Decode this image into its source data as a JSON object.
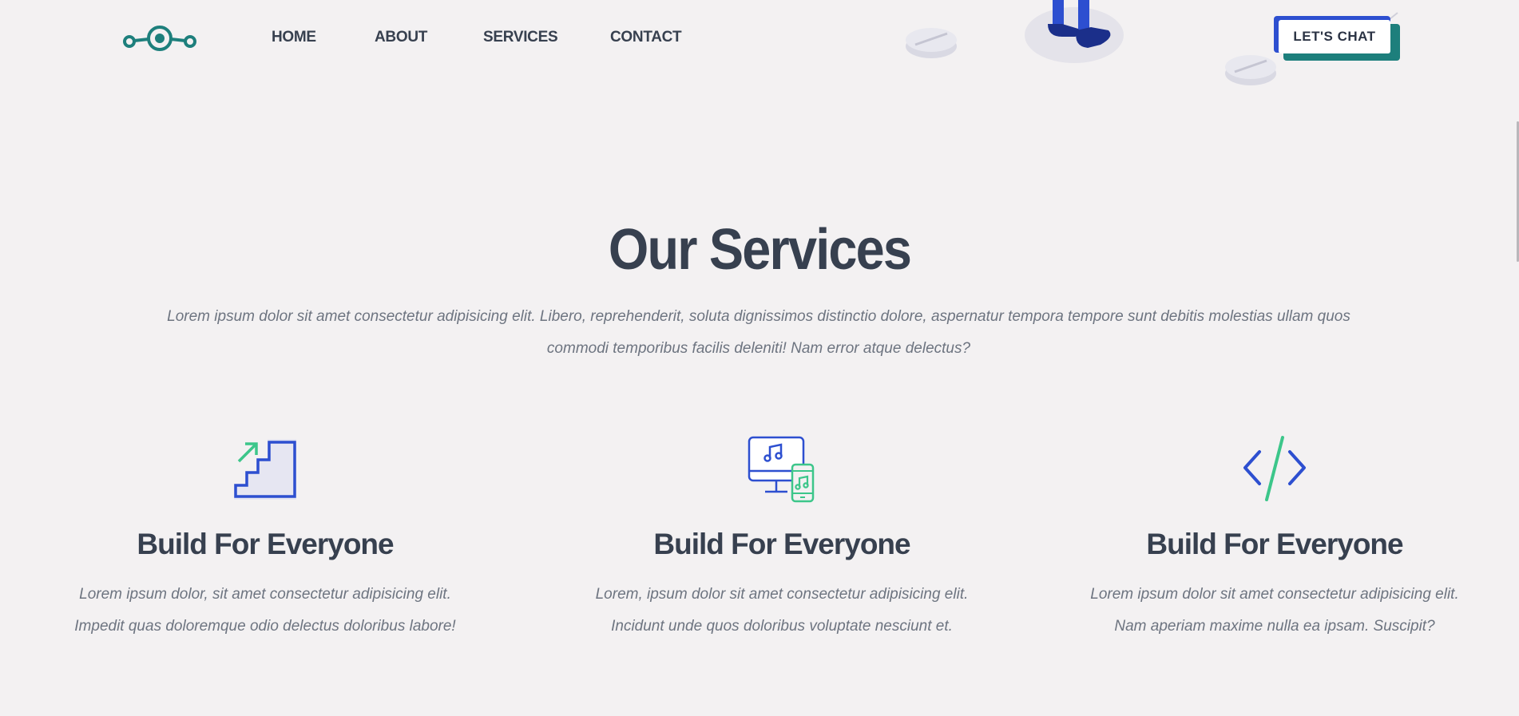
{
  "nav": {
    "items": [
      {
        "label": "HOME"
      },
      {
        "label": "ABOUT"
      },
      {
        "label": "SERVICES"
      },
      {
        "label": "CONTACT"
      }
    ],
    "cta_label": "LET'S CHAT"
  },
  "services": {
    "title": "Our Services",
    "intro_line1": "Lorem ipsum dolor sit amet consectetur adipisicing elit. Libero, reprehenderit, soluta dignissimos distinctio dolore, aspernatur tempora tempore sunt debitis molestias ullam quos",
    "intro_line2": "commodi temporibus facilis deleniti! Nam error atque delectus?",
    "cards": [
      {
        "icon": "stairs-growth-icon",
        "title": "Build For Everyone",
        "line1": "Lorem ipsum dolor, sit amet consectetur adipisicing elit.",
        "line2": "Impedit quas doloremque odio delectus doloribus labore!"
      },
      {
        "icon": "multi-device-music-icon",
        "title": "Build For Everyone",
        "line1": "Lorem, ipsum dolor sit amet consectetur adipisicing elit.",
        "line2": "Incidunt unde quos doloribus voluptate nesciunt et."
      },
      {
        "icon": "code-brackets-icon",
        "title": "Build For Everyone",
        "line1": "Lorem ipsum dolor sit amet consectetur adipisicing elit.",
        "line2": "Nam aperiam maxime nulla ea ipsam. Suscipit?"
      }
    ]
  },
  "colors": {
    "background": "#f3f1f2",
    "heading": "#37404f",
    "body_text": "#6d7480",
    "brand_teal": "#1d7f7c",
    "accent_blue": "#2d4fd0",
    "accent_green": "#3cc68a"
  }
}
